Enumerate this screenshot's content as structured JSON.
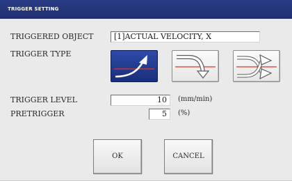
{
  "window": {
    "title": "TRIGGER SETTING"
  },
  "form": {
    "triggered_object_label": "TRIGGERED OBJECT",
    "triggered_object_value": "[1]ACTUAL VELOCITY, X",
    "trigger_type_label": "TRIGGER TYPE",
    "trigger_types": [
      {
        "name": "rising-edge",
        "selected": true,
        "icon": "rising-edge-icon"
      },
      {
        "name": "falling-edge",
        "selected": false,
        "icon": "falling-edge-icon"
      },
      {
        "name": "both-edges",
        "selected": false,
        "icon": "both-edges-icon"
      }
    ],
    "trigger_level_label": "TRIGGER LEVEL",
    "trigger_level_value": "10",
    "trigger_level_unit": "(mm/min)",
    "pretrigger_label": "PRETRIGGER",
    "pretrigger_value": "5",
    "pretrigger_unit": "(%)"
  },
  "buttons": {
    "ok_label": "OK",
    "cancel_label": "CANCEL"
  },
  "colors": {
    "titlebar": "#1f2f70",
    "selected_button": "#1a2e7c",
    "trigger_line": "#d83a2a"
  }
}
